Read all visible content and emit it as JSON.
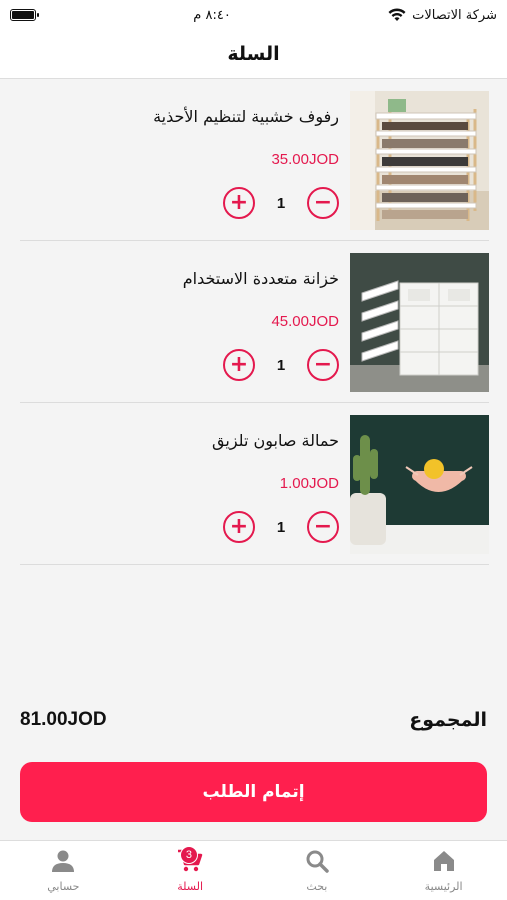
{
  "status_bar": {
    "carrier": "شركة الاتصالات",
    "time": "٨:٤٠ م"
  },
  "header": {
    "title": "السلة"
  },
  "cart": {
    "items": [
      {
        "name": "رفوف خشبية لتنظيم الأحذية",
        "price": "35.00JOD",
        "quantity": "1"
      },
      {
        "name": "خزانة متعددة الاستخدام",
        "price": "45.00JOD",
        "quantity": "1"
      },
      {
        "name": "حمالة صابون تلزيق",
        "price": "1.00JOD",
        "quantity": "1"
      }
    ]
  },
  "summary": {
    "total_label": "المجموع",
    "total_amount": "81.00JOD"
  },
  "checkout": {
    "label": "إتمام الطلب"
  },
  "tab_bar": {
    "tabs": [
      {
        "label": "الرئيسية",
        "icon": "home-icon"
      },
      {
        "label": "بحث",
        "icon": "search-icon"
      },
      {
        "label": "السلة",
        "icon": "cart-icon",
        "badge": "3"
      },
      {
        "label": "حسابي",
        "icon": "user-icon"
      }
    ]
  },
  "colors": {
    "accent": "#e4194e",
    "button": "#ff1f4e"
  }
}
